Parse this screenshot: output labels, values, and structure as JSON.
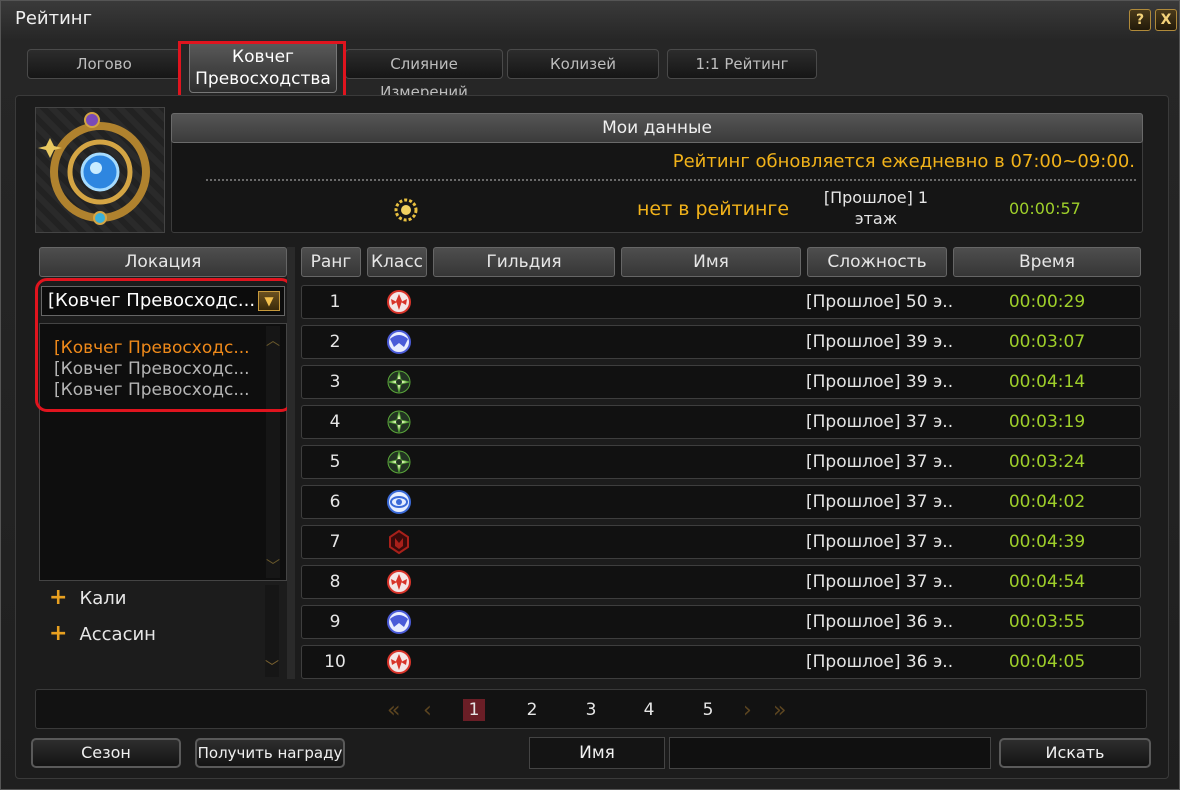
{
  "window": {
    "title": "Рейтинг",
    "help_label": "?",
    "close_label": "X"
  },
  "tabs": [
    {
      "label": "Логово"
    },
    {
      "label": "Ковчег Превосходства"
    },
    {
      "label": "Слияние Измерений"
    },
    {
      "label": "Колизей"
    },
    {
      "label": "1:1 Рейтинг"
    }
  ],
  "my_data": {
    "header": "Мои данные",
    "notice": "Рейтинг обновляется ежедневно в 07:00~09:00.",
    "rank": "нет в рейтинге",
    "difficulty_line1": "[Прошлое] 1",
    "difficulty_line2": "этаж",
    "time": "00:00:57",
    "class_icon": "gear-sun-icon"
  },
  "location": {
    "header": "Локация",
    "selected": "[Ковчег Превосходс...",
    "options": [
      {
        "label": "[Ковчег Превосходс...",
        "selected": true
      },
      {
        "label": "[Ковчег Превосходс...",
        "selected": false
      },
      {
        "label": "[Ковчег Превосходс...",
        "selected": false
      }
    ],
    "tree": [
      {
        "label": "Кали"
      },
      {
        "label": "Ассасин"
      }
    ]
  },
  "table": {
    "headers": {
      "rank": "Ранг",
      "class": "Класс",
      "guild": "Гильдия",
      "name": "Имя",
      "difficulty": "Сложность",
      "time": "Время"
    },
    "rows": [
      {
        "rank": "1",
        "class_icon": "phoenix-class-icon",
        "class_color": "#d8342a",
        "difficulty": "[Прошлое] 50 э...",
        "time": "00:00:29"
      },
      {
        "rank": "2",
        "class_icon": "winged-class-icon",
        "class_color": "#4a5bd8",
        "difficulty": "[Прошлое] 39 э...",
        "time": "00:03:07"
      },
      {
        "rank": "3",
        "class_icon": "shuriken-class-icon",
        "class_color": "#5aa83a",
        "difficulty": "[Прошлое] 39 э...",
        "time": "00:04:14"
      },
      {
        "rank": "4",
        "class_icon": "shuriken-class-icon",
        "class_color": "#5aa83a",
        "difficulty": "[Прошлое] 37 э...",
        "time": "00:03:19"
      },
      {
        "rank": "5",
        "class_icon": "shuriken-class-icon",
        "class_color": "#5aa83a",
        "difficulty": "[Прошлое] 37 э...",
        "time": "00:03:24"
      },
      {
        "rank": "6",
        "class_icon": "eye-class-icon",
        "class_color": "#3a6ad8",
        "difficulty": "[Прошлое] 37 э...",
        "time": "00:04:02"
      },
      {
        "rank": "7",
        "class_icon": "demon-class-icon",
        "class_color": "#a8201a",
        "difficulty": "[Прошлое] 37 э...",
        "time": "00:04:39"
      },
      {
        "rank": "8",
        "class_icon": "phoenix-class-icon",
        "class_color": "#d8342a",
        "difficulty": "[Прошлое] 37 э...",
        "time": "00:04:54"
      },
      {
        "rank": "9",
        "class_icon": "winged-class-icon",
        "class_color": "#4a5bd8",
        "difficulty": "[Прошлое] 36 э...",
        "time": "00:03:55"
      },
      {
        "rank": "10",
        "class_icon": "phoenix-class-icon",
        "class_color": "#d8342a",
        "difficulty": "[Прошлое] 36 э...",
        "time": "00:04:05"
      }
    ]
  },
  "pager": {
    "pages": [
      "1",
      "2",
      "3",
      "4",
      "5"
    ],
    "current": "1"
  },
  "footer": {
    "season_label": "Сезон",
    "reward_label": "Получить награду",
    "name_label": "Имя",
    "search_label": "Искать"
  }
}
